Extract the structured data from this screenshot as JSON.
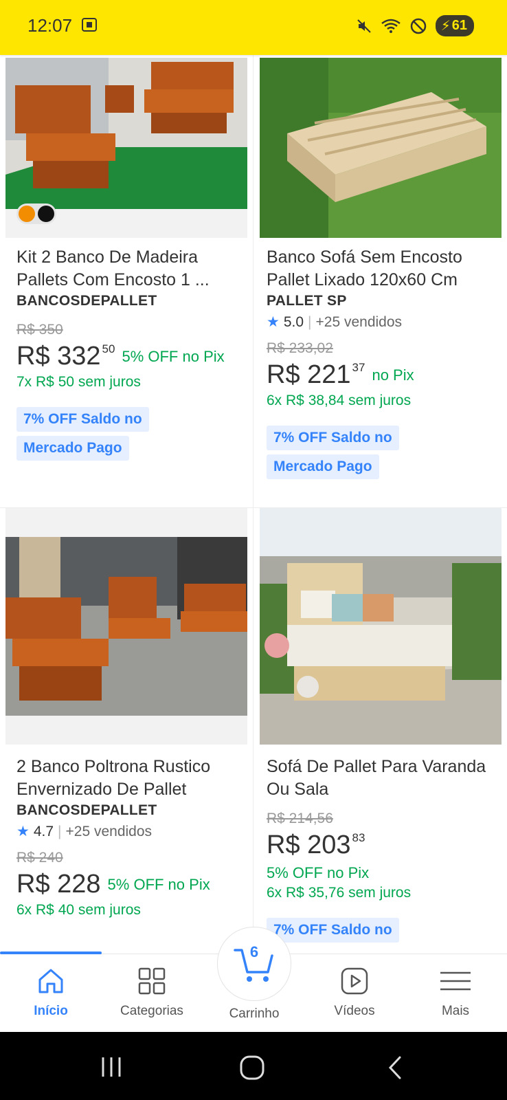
{
  "status_bar": {
    "time": "12:07",
    "battery": "61"
  },
  "products": [
    {
      "title": "Kit 2 Banco De Madeira Pallets Com Encosto 1 ...",
      "seller": "BANCOSDEPALLET",
      "old_price": "R$ 350",
      "price": "R$ 332",
      "cents": "50",
      "pix": "5% OFF no Pix",
      "installments": "7x R$ 50 sem juros",
      "tag_line1": "7% OFF Saldo no",
      "tag_line2": "Mercado Pago",
      "color_swatches": [
        "#f28c00",
        "#111111"
      ]
    },
    {
      "title": "Banco Sofá Sem Encosto Pallet Lixado 120x60 Cm",
      "seller": "PALLET SP",
      "rating": "5.0",
      "sold": "+25 vendidos",
      "old_price": "R$ 233,02",
      "price": "R$ 221",
      "cents": "37",
      "pix": "no Pix",
      "installments": "6x R$ 38,84 sem juros",
      "tag_line1": "7% OFF Saldo no",
      "tag_line2": "Mercado Pago"
    },
    {
      "title": "2 Banco Poltrona Rustico Envernizado De Pallet",
      "seller": "BANCOSDEPALLET",
      "rating": "4.7",
      "sold": "+25 vendidos",
      "old_price": "R$ 240",
      "price": "R$ 228",
      "pix": "5% OFF no Pix",
      "installments": "6x R$ 40 sem juros"
    },
    {
      "title": "Sofá De Pallet Para Varanda Ou Sala",
      "old_price": "R$ 214,56",
      "price": "R$ 203",
      "cents": "83",
      "pix": "5% OFF no Pix",
      "installments": "6x R$ 35,76 sem juros",
      "tag_line1": "7% OFF Saldo no"
    }
  ],
  "bottom_nav": {
    "home": "Início",
    "categories": "Categorias",
    "cart": "Carrinho",
    "cart_count": "6",
    "videos": "Vídeos",
    "more": "Mais"
  },
  "colors": {
    "accent": "#3483fa",
    "brand_yellow": "#ffe600",
    "green": "#00a650"
  }
}
